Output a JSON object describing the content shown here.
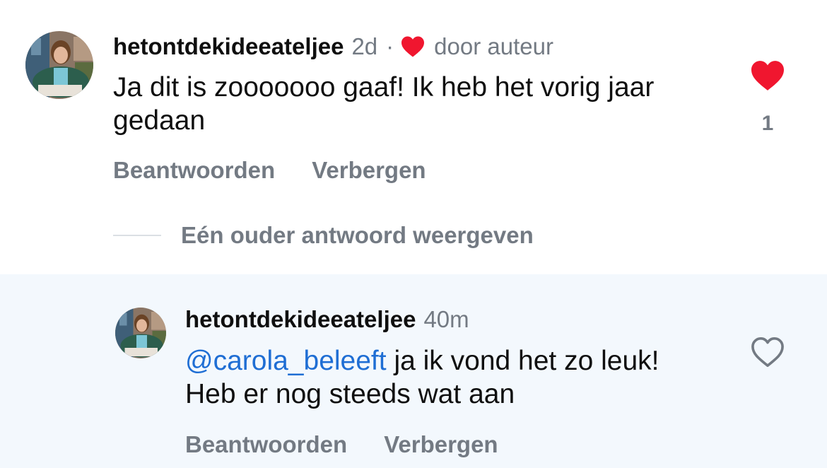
{
  "colors": {
    "text": "#0f0f0f",
    "secondary": "#737a83",
    "heart_red": "#f0162f",
    "mention_blue": "#1f6ed4",
    "reply_background": "#f3f8fd"
  },
  "comment": {
    "username": "hetontdekideeateljee",
    "time": "2d",
    "separator": "·",
    "author_like_icon": "heart-filled-icon",
    "author_like_label": "door auteur",
    "text": "Ja dit is zooooooo gaaf! Ik heb het vorig jaar gedaan",
    "reply_label": "Beantwoorden",
    "hide_label": "Verbergen",
    "like_icon": "heart-filled-icon",
    "like_count": "1",
    "liked": true
  },
  "more_replies_label": "Eén ouder antwoord weergeven",
  "reply": {
    "username": "hetontdekideeateljee",
    "time": "40m",
    "mention": "@carola_beleeft",
    "text": " ja ik vond het zo leuk! Heb er nog steeds wat aan",
    "reply_label": "Beantwoorden",
    "hide_label": "Verbergen",
    "like_icon": "heart-outline-icon",
    "liked": false
  }
}
